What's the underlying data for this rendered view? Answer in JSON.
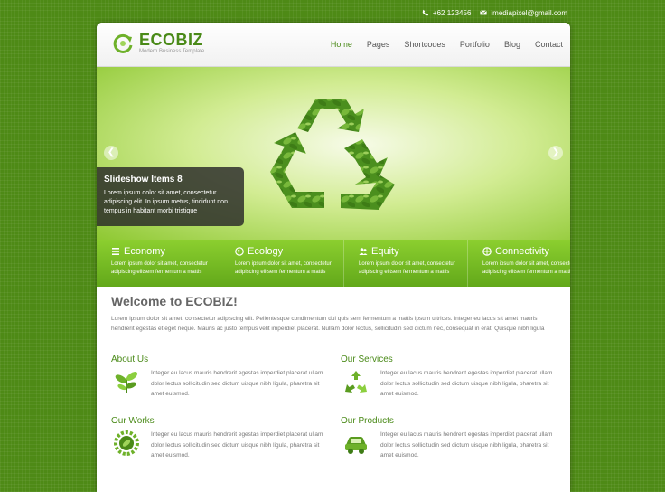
{
  "topbar": {
    "phone": "+62 123456",
    "email": "imediapixel@gmail.com"
  },
  "brand": {
    "name": "ECOBIZ",
    "tagline": "Modern Business Template"
  },
  "nav": [
    {
      "label": "Home",
      "active": true
    },
    {
      "label": "Pages",
      "active": false
    },
    {
      "label": "Shortcodes",
      "active": false
    },
    {
      "label": "Portfolio",
      "active": false
    },
    {
      "label": "Blog",
      "active": false
    },
    {
      "label": "Contact",
      "active": false
    }
  ],
  "slider": {
    "caption_title": "Slideshow Items 8",
    "caption_text": "Lorem ipsum dolor sit amet, consectetur adipiscing elit. In ipsum metus, tincidunt non tempus in habitant morbi tristique",
    "image": "recycle-leaves-icon"
  },
  "features": [
    {
      "title": "Economy",
      "icon": "list-icon",
      "text": "Lorem ipsum dolor sit amet, consectetur adipiscing elitsem fermentum a mattis"
    },
    {
      "title": "Ecology",
      "icon": "globe-icon",
      "text": "Lorem ipsum dolor sit amet, consectetur adipiscing elitsem fermentum a mattis"
    },
    {
      "title": "Equity",
      "icon": "people-icon",
      "text": "Lorem ipsum dolor sit amet, consectetur adipiscing elitsem fermentum a mattis"
    },
    {
      "title": "Connectivity",
      "icon": "network-icon",
      "text": "Lorem ipsum dolor sit amet, consectetur adipiscing elitsem fermentum a mattis"
    }
  ],
  "welcome": {
    "title": "Welcome to ECOBIZ!",
    "text": "Lorem ipsum dolor sit amet, consectetur adipiscing elit. Pellentesque condimentum dui quis sem fermentum a mattis ipsum ultrices. Integer eu lacus sit amet mauris hendrerit egestas et eget neque. Mauris ac justo tempus velit imperdiet placerat. Nullam dolor lectus, sollicitudin sed dictum nec, consequat in erat. Quisque nibh ligula"
  },
  "blocks": [
    {
      "title": "About Us",
      "icon": "plant-icon",
      "text": "Integer eu lacus mauris hendrerit egestas imperdiet placerat ullam dolor lectus sollicitudin sed dictum uisque nibh ligula, pharetra sit amet euismod."
    },
    {
      "title": "Our Services",
      "icon": "recycle-icon",
      "text": "Integer eu lacus mauris hendrerit egestas imperdiet placerat ullam dolor lectus sollicitudin sed dictum uisque nibh ligula, pharetra sit amet euismod."
    },
    {
      "title": "Our Works",
      "icon": "gear-leaf-icon",
      "text": "Integer eu lacus mauris hendrerit egestas imperdiet placerat ullam dolor lectus sollicitudin sed dictum uisque nibh ligula, pharetra sit amet euismod."
    },
    {
      "title": "Our Products",
      "icon": "eco-car-icon",
      "text": "Integer eu lacus mauris hendrerit egestas imperdiet placerat ullam dolor lectus sollicitudin sed dictum uisque nibh ligula, pharetra sit amet euismod."
    }
  ],
  "colors": {
    "brand_green": "#4a8a18",
    "bg_green": "#4e8a16",
    "feature_bar": "#6fb620"
  }
}
